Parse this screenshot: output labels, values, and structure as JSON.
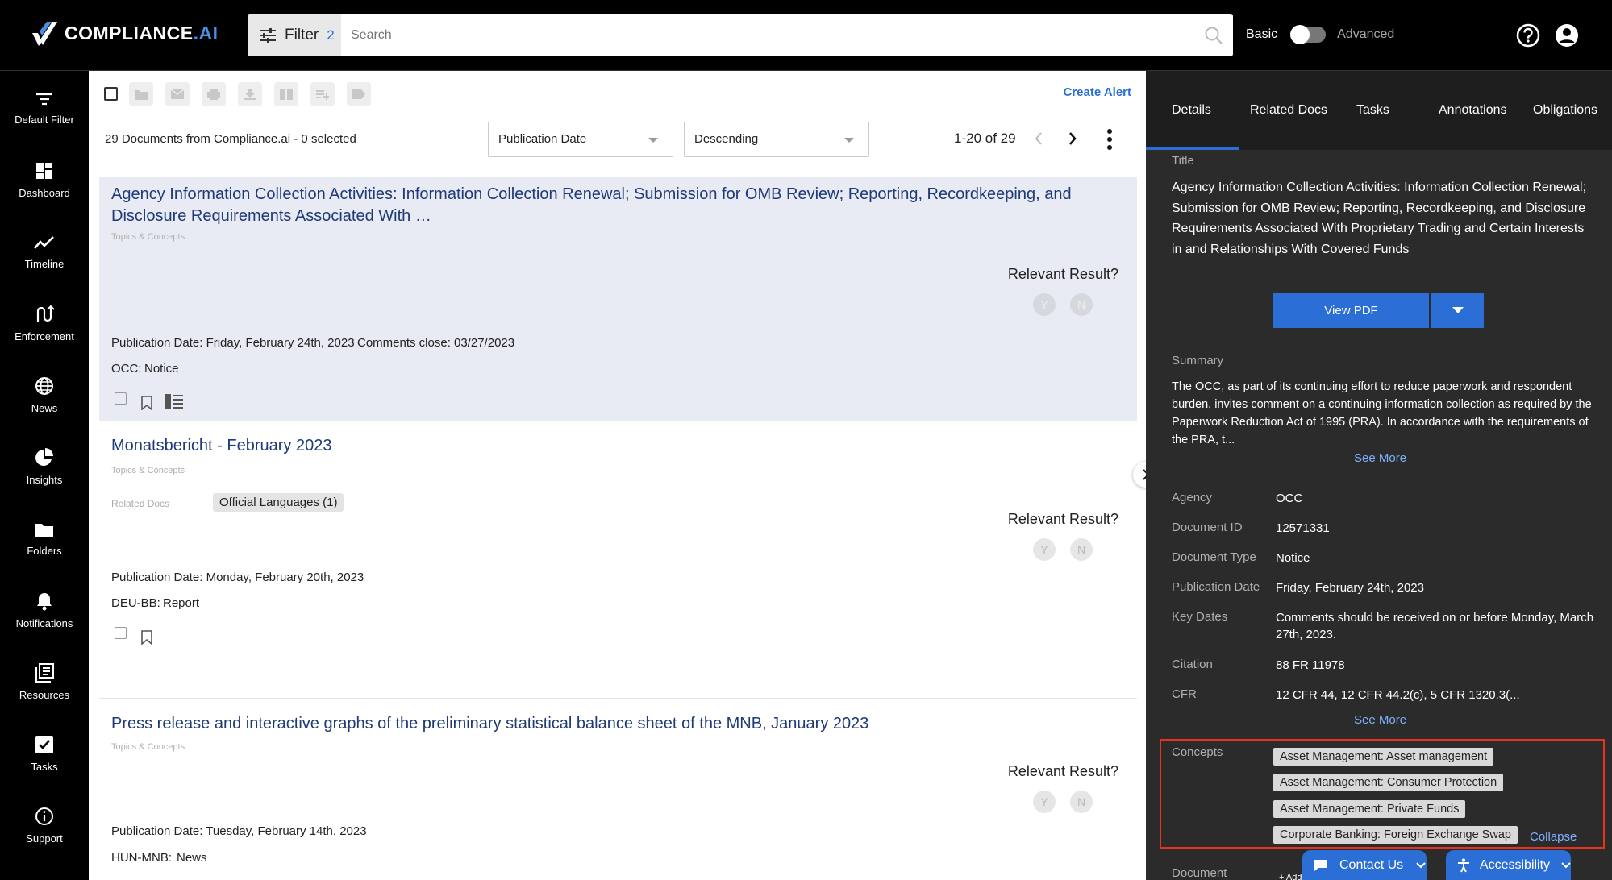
{
  "app": {
    "brand": "COMPLIANCE",
    "brand_suffix": ".AI"
  },
  "search": {
    "filter_label": "Filter",
    "filter_count": "2",
    "placeholder": "Search",
    "toggle_basic": "Basic",
    "toggle_advanced": "Advanced"
  },
  "nav": {
    "items": [
      {
        "label": "Default Filter",
        "icon": "filter-icon"
      },
      {
        "label": "Dashboard",
        "icon": "dashboard-icon"
      },
      {
        "label": "Timeline",
        "icon": "timeline-icon"
      },
      {
        "label": "Enforcement",
        "icon": "enforcement-icon"
      },
      {
        "label": "News",
        "icon": "globe-icon"
      },
      {
        "label": "Insights",
        "icon": "pie-chart-icon"
      },
      {
        "label": "Folders",
        "icon": "folder-icon"
      },
      {
        "label": "Notifications",
        "icon": "bell-icon"
      },
      {
        "label": "Resources",
        "icon": "resources-icon"
      },
      {
        "label": "Tasks",
        "icon": "task-check-icon"
      },
      {
        "label": "Support",
        "icon": "info-icon"
      }
    ]
  },
  "toolbar": {
    "create_alert": "Create Alert",
    "count_text": "29 Documents from Compliance.ai - 0 selected",
    "sort_field": "Publication Date",
    "sort_order": "Descending",
    "pager": "1-20 of 29"
  },
  "results": [
    {
      "title": "Agency Information Collection Activities: Information Collection Renewal; Submission for OMB Review; Reporting, Recordkeeping, and Disclosure Requirements Associated With …",
      "topics": "Topics & Concepts",
      "relevant": "Relevant Result?",
      "yes": "Y",
      "no": "N",
      "pub_date": "Publication Date: Friday, February 24th, 2023",
      "comments": "Comments close:  03/27/2023",
      "agency": "OCC:",
      "doc_type": "Notice"
    },
    {
      "title": "Monatsbericht - February 2023",
      "topics": "Topics & Concepts",
      "related_label": "Related Docs",
      "related_chip": "Official Languages (1)",
      "relevant": "Relevant Result?",
      "yes": "Y",
      "no": "N",
      "pub_date": "Publication Date: Monday, February 20th, 2023",
      "agency": "DEU-BB:",
      "doc_type": "Report"
    },
    {
      "title": "Press release and interactive graphs of the preliminary statistical balance sheet of the MNB, January 2023",
      "topics": "Topics & Concepts",
      "relevant": "Relevant Result?",
      "yes": "Y",
      "no": "N",
      "pub_date": "Publication Date: Tuesday, February 14th, 2023",
      "agency": "HUN-MNB:",
      "doc_type": "News"
    }
  ],
  "details": {
    "tabs": [
      "Details",
      "Related Docs",
      "Tasks",
      "Annotations",
      "Obligations"
    ],
    "title_label": "Title",
    "title": "Agency Information Collection Activities: Information Collection Renewal; Submission for OMB Review; Reporting, Recordkeeping, and Disclosure Requirements Associated With Proprietary Trading and Certain Interests in and Relationships With Covered Funds",
    "view_pdf": "View PDF",
    "summary_label": "Summary",
    "summary": "The OCC, as part of its continuing effort to reduce paperwork and respondent burden, invites comment on a continuing information collection as required by the Paperwork Reduction Act of 1995 (PRA). In accordance with the requirements of the PRA, t...",
    "see_more": "See More",
    "fields": [
      {
        "label": "Agency",
        "value": "OCC"
      },
      {
        "label": "Document ID",
        "value": "12571331"
      },
      {
        "label": "Document Type",
        "value": "Notice"
      },
      {
        "label": "Publication Date",
        "value": "Friday, February 24th, 2023"
      },
      {
        "label": "Key Dates",
        "value": "Comments should be received on or before Monday, March 27th, 2023."
      },
      {
        "label": "Citation",
        "value": "88 FR 11978"
      },
      {
        "label": "CFR",
        "value": "12 CFR 44, 12 CFR 44.2(c), 5 CFR 1320.3(..."
      }
    ],
    "concepts_label": "Concepts",
    "concepts": [
      "Asset Management: Asset management",
      "Asset Management: Consumer Protection",
      "Asset Management: Private Funds",
      "Corporate Banking: Foreign Exchange Swap"
    ],
    "collapse": "Collapse",
    "document_label": "Document",
    "add_label": "+ Add"
  },
  "footer": {
    "contact_us": "Contact Us",
    "accessibility": "Accessibility"
  },
  "colors": {
    "accent": "#2b6fd6",
    "title_link": "#1f3a78",
    "highlight_border": "#e8331c",
    "panel_bg": "#2b2b2b"
  }
}
